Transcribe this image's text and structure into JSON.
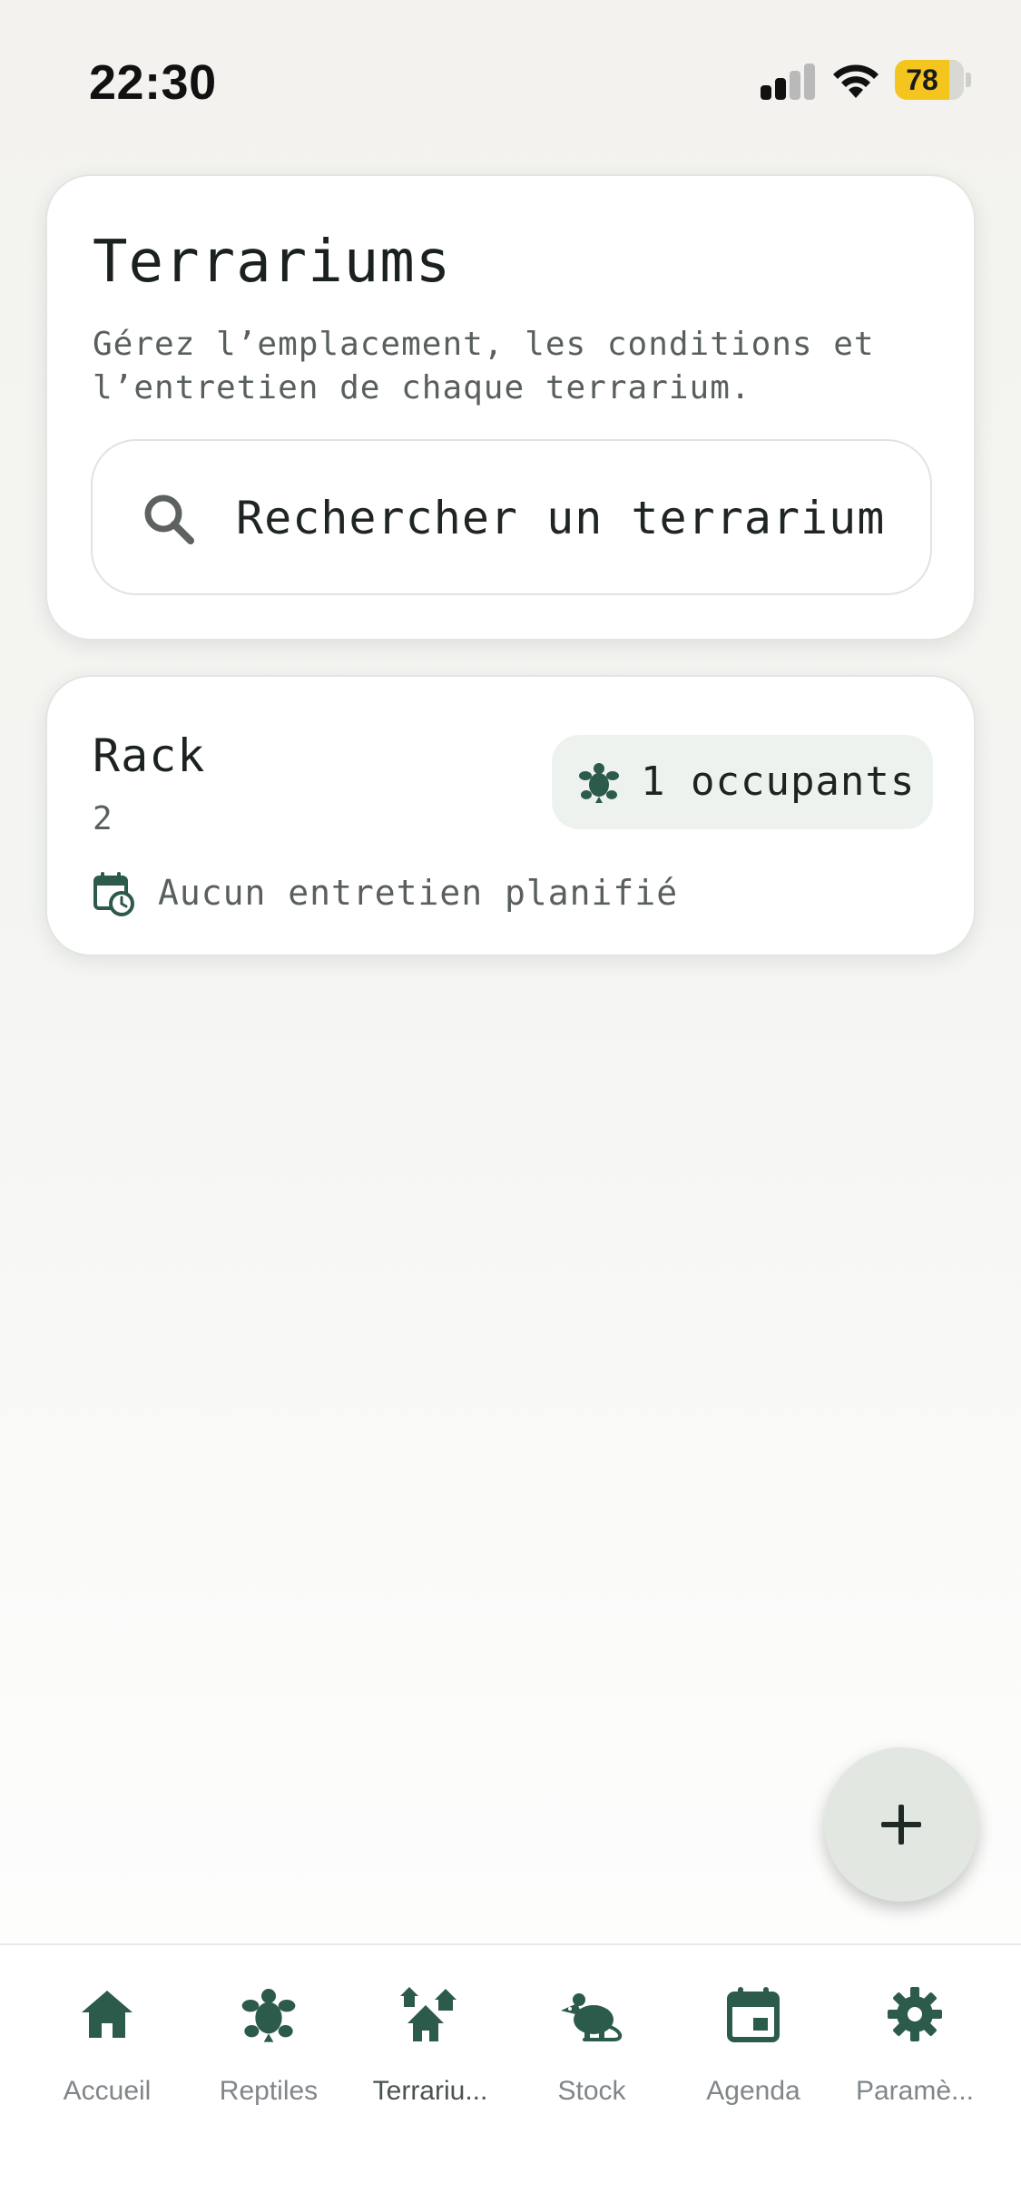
{
  "status_bar": {
    "time": "22:30",
    "battery": "78"
  },
  "header": {
    "title": "Terrariums",
    "subtitle": "Gérez l’emplacement, les conditions et l’entretien de chaque terrarium.",
    "search_placeholder": "Rechercher un terrarium"
  },
  "terrariums": [
    {
      "name": "Rack",
      "subtitle": "2",
      "occupants": "1 occupants",
      "maintenance": "Aucun entretien planifié"
    }
  ],
  "bottom_nav": [
    {
      "label": "Accueil",
      "icon": "home-icon"
    },
    {
      "label": "Reptiles",
      "icon": "turtle-icon"
    },
    {
      "label": "Terrariu...",
      "icon": "houses-icon"
    },
    {
      "label": "Stock",
      "icon": "rat-icon"
    },
    {
      "label": "Agenda",
      "icon": "calendar-icon"
    },
    {
      "label": "Paramè...",
      "icon": "gear-icon"
    }
  ],
  "colors": {
    "accent": "#2c5a4b",
    "battery": "#f4c51f",
    "background": "#f3f2ee"
  }
}
